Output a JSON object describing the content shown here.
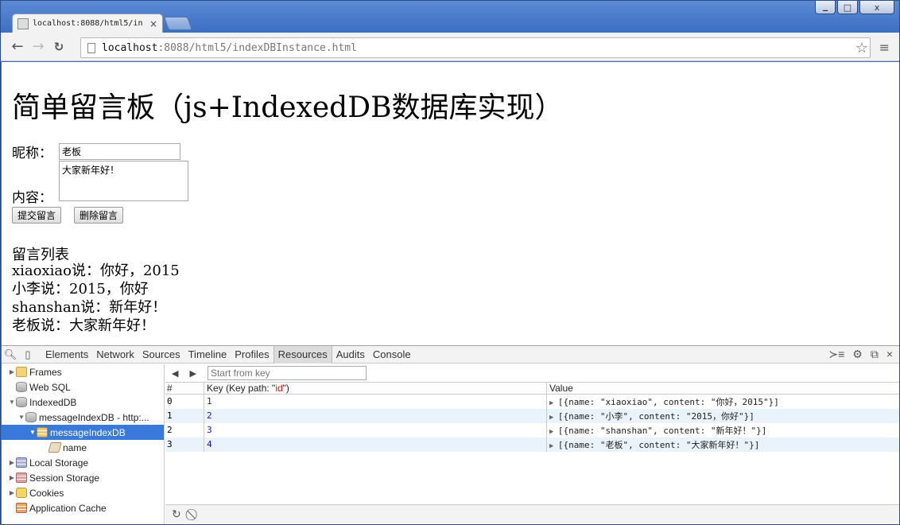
{
  "browser": {
    "tab_title": "localhost:8088/html5/in",
    "tab_close": "×",
    "url_host": "localhost",
    "url_rest": ":8088/html5/indexDBInstance.html",
    "back_icon": "←",
    "forward_icon": "→",
    "reload_icon": "C",
    "star_icon": "☆",
    "menu_icon": "≡",
    "win_min": "▭",
    "win_max": "□",
    "win_close": "x"
  },
  "page": {
    "heading": "简单留言板（js+IndexedDB数据库实现）",
    "nick_label": "昵称：",
    "nick_value": "老板",
    "content_label": "内容：",
    "content_value": "大家新年好！",
    "submit_label": "提交留言",
    "delete_label": "删除留言",
    "list_title": "留言列表",
    "messages": [
      "xiaoxiao说：你好，2015",
      "小李说：2015，你好",
      "shanshan说：新年好！",
      "老板说：大家新年好！"
    ]
  },
  "devtools": {
    "tabs": [
      "Elements",
      "Network",
      "Sources",
      "Timeline",
      "Profiles",
      "Resources",
      "Audits",
      "Console"
    ],
    "active_tab": "Resources",
    "sidebar": [
      {
        "label": "Frames"
      },
      {
        "label": "Web SQL"
      },
      {
        "label": "IndexedDB"
      },
      {
        "label": "messageIndexDB - http:..."
      },
      {
        "label": "messageIndexDB"
      },
      {
        "label": "name"
      },
      {
        "label": "Local Storage"
      },
      {
        "label": "Session Storage"
      },
      {
        "label": "Cookies"
      },
      {
        "label": "Application Cache"
      }
    ],
    "start_from_key_placeholder": "Start from key",
    "columns": {
      "num": "#",
      "key_prefix": "Key (Key path: \"",
      "key_path": "id",
      "key_suffix": "\")",
      "value": "Value"
    },
    "rows": [
      {
        "num": "0",
        "key": "1",
        "value": "[{name: \"xiaoxiao\", content: \"你好，2015\"}]"
      },
      {
        "num": "1",
        "key": "2",
        "value": "[{name: \"小李\", content: \"2015，你好\"}]"
      },
      {
        "num": "2",
        "key": "3",
        "value": "[{name: \"shanshan\", content: \"新年好！\"}]"
      },
      {
        "num": "3",
        "key": "4",
        "value": "[{name: \"老板\", content: \"大家新年好！\"}]"
      }
    ]
  }
}
